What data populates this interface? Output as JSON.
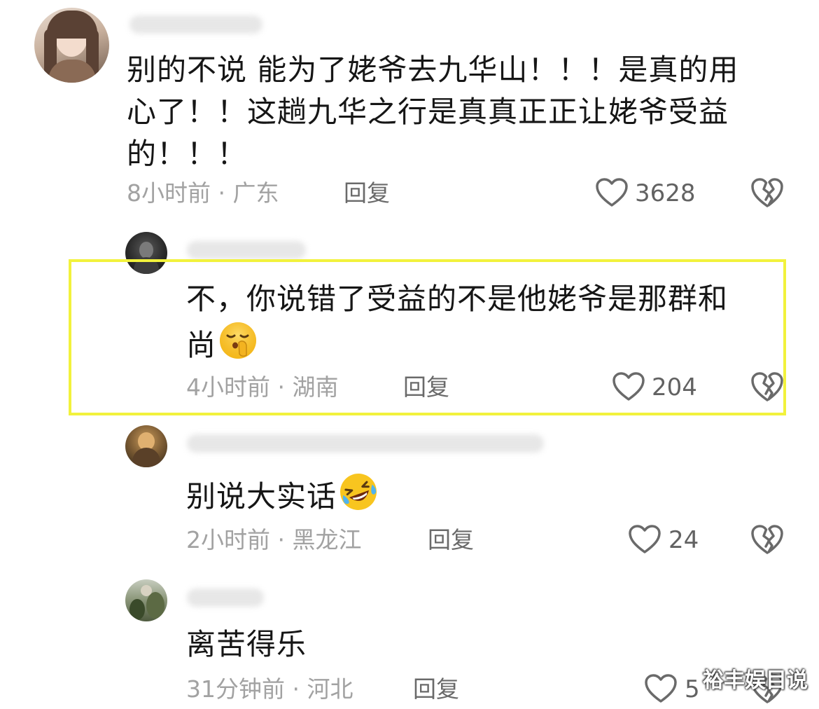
{
  "comments": [
    {
      "text_lines": [
        "别的不说  能为了姥爷去九华山！！！是真的用",
        "心了！！这趟九华之行是真真正正让姥爷受益",
        "的！！！"
      ],
      "meta": "8小时前 · 广东",
      "reply": "回复",
      "likes": "3628"
    },
    {
      "text_lines": [
        "不，你说错了受益的不是他姥爷是那群和",
        "尚"
      ],
      "emoji": "shushing-face-emoji",
      "meta": "4小时前 · 湖南",
      "reply": "回复",
      "likes": "204"
    },
    {
      "text_lines": [
        "别说大实话"
      ],
      "emoji": "rolling-laughing-emoji",
      "meta": "2小时前 · 黑龙江",
      "reply": "回复",
      "likes": "24"
    },
    {
      "text_lines": [
        "离苦得乐"
      ],
      "meta": "31分钟前 · 河北",
      "reply": "回复",
      "likes": "5"
    }
  ],
  "watermark": "裕丰娱目说",
  "colors": {
    "highlight": "#f2f23c",
    "meta_text": "#a2a2a2",
    "icon_stroke": "#6a6a6a"
  },
  "icons": {
    "like": "heart-outline-icon",
    "dislike": "broken-heart-icon"
  }
}
